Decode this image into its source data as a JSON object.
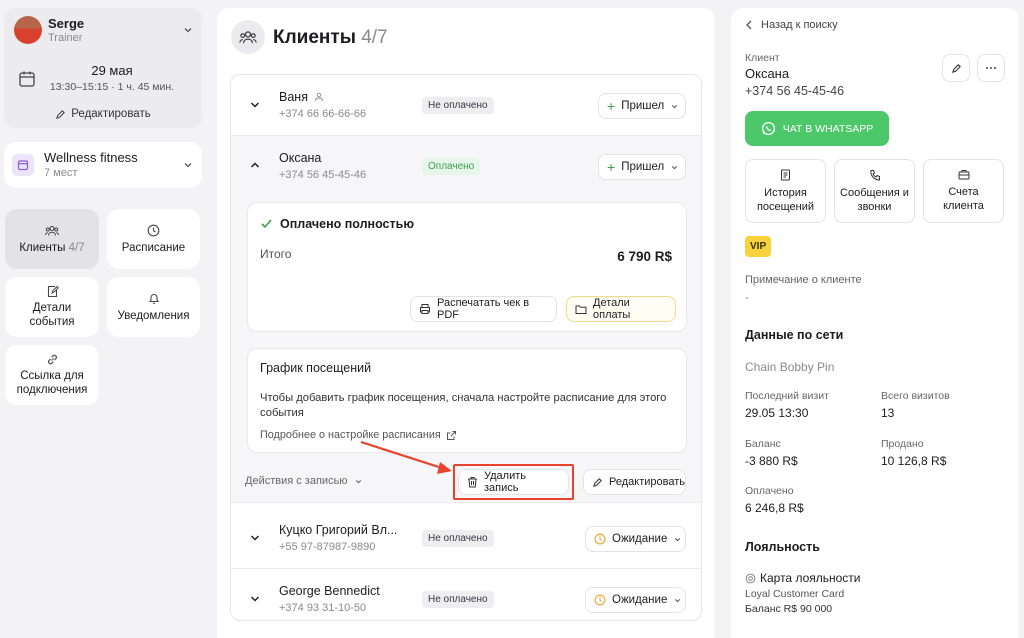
{
  "user": {
    "name": "Serge",
    "role": "Trainer"
  },
  "event": {
    "date": "29 мая",
    "time": "13:30–15:15 · 1 ч. 45 мин.",
    "edit_label": "Редактировать"
  },
  "venue": {
    "name": "Wellness fitness",
    "places": "7 мест"
  },
  "nav": {
    "clients": "Клиенты",
    "clients_count": "4/7",
    "schedule": "Расписание",
    "details": "Детали события",
    "notifications": "Уведомления",
    "link": "Ссылка для подключения"
  },
  "main": {
    "title": "Клиенты",
    "count": "4/7",
    "clients": [
      {
        "name": "Ваня",
        "phone": "+374 66 66-66-66",
        "status": "Не оплачено",
        "action": "Пришел"
      },
      {
        "name": "Оксана",
        "phone": "+374 56 45-45-46",
        "status": "Оплачено",
        "action": "Пришел"
      },
      {
        "name": "Куцко Григорий Вл...",
        "phone": "+55 97-87987-9890",
        "status": "Не оплачено",
        "action": "Ожидание"
      },
      {
        "name": "George Bennedict",
        "phone": "+374 93 31-10-50",
        "status": "Не оплачено",
        "action": "Ожидание"
      }
    ],
    "payment": {
      "paid_full": "Оплачено полностью",
      "total_label": "Итого",
      "total_value": "6 790 R$",
      "print_pdf": "Распечатать чек в PDF",
      "payment_details": "Детали оплаты"
    },
    "visits": {
      "title": "График посещений",
      "text": "Чтобы добавить график посещения, сначала настройте расписание для этого события",
      "link": "Подробнее о настройке расписания"
    },
    "actions": {
      "label": "Действия с записью",
      "delete": "Удалить запись",
      "edit": "Редактировать"
    }
  },
  "panel": {
    "back": "Назад к поиску",
    "client_label": "Клиент",
    "client_name": "Оксана",
    "client_phone": "+374 56 45-45-46",
    "whatsapp": "ЧАТ В WHATSAPP",
    "tiles": [
      "История посещений",
      "Сообщения и звонки",
      "Счета клиента"
    ],
    "vip": "VIP",
    "note_label": "Примечание о клиенте",
    "note_value": "-",
    "network_title": "Данные по сети",
    "network_name": "Chain Bobby Pin",
    "last_visit_label": "Последний визит",
    "last_visit": "29.05 13:30",
    "total_visits_label": "Всего визитов",
    "total_visits": "13",
    "balance_label": "Баланс",
    "balance": "-3 880 R$",
    "sold_label": "Продано",
    "sold": "10 126,8 R$",
    "paid_label": "Оплачено",
    "paid": "6 246,8 R$",
    "loyalty_title": "Лояльность",
    "loyalty_card": "Карта лояльности",
    "loyalty_card_name": "Loyal Customer Card",
    "loyalty_balance": "Баланс R$ 90 000"
  },
  "colors": {
    "whatsapp": "#4cc86a",
    "vip": "#f6d23c",
    "highlight": "#e8432c",
    "waiting": "#f0a93a",
    "paid": "#3aa052"
  }
}
